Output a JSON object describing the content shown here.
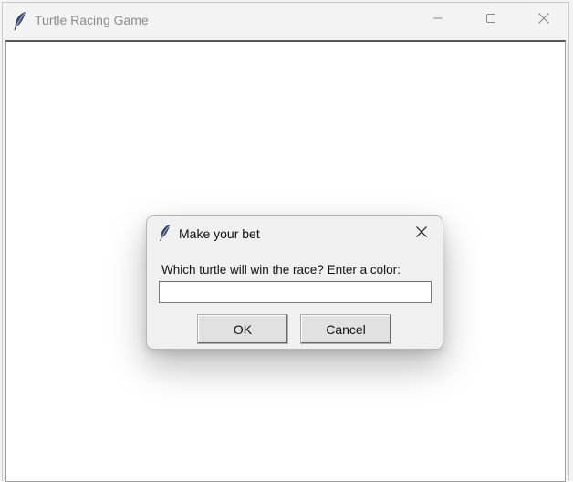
{
  "window": {
    "title": "Turtle Racing Game",
    "icon": "feather-icon",
    "controls": [
      "minimize-icon",
      "maximize-icon",
      "close-icon"
    ]
  },
  "dialog": {
    "title": "Make your bet",
    "icon": "feather-icon",
    "prompt": "Which turtle will win the race? Enter a color:",
    "input_value": "",
    "ok_label": "OK",
    "cancel_label": "Cancel"
  },
  "colors": {
    "titlebar": "#f3f3f3",
    "canvas": "#ffffff",
    "dialog_bg": "#f0f0f0",
    "feather": "#3b4a72"
  }
}
